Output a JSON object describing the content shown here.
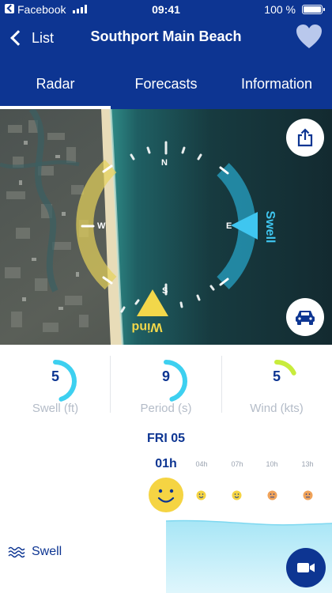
{
  "status_bar": {
    "app_name": "Facebook",
    "time": "09:41",
    "battery": "100 %"
  },
  "nav": {
    "back_label": "List",
    "title": "Southport Main Beach",
    "favorite_icon": "heart-icon"
  },
  "tabs": [
    {
      "label": "Radar",
      "active": true
    },
    {
      "label": "Forecasts",
      "active": false
    },
    {
      "label": "Information",
      "active": false
    }
  ],
  "radar": {
    "compass": {
      "north": "N",
      "south": "S",
      "east": "E",
      "west": "W"
    },
    "swell_label": "Swell",
    "wind_label": "Wind",
    "swell_color": "#2bbde6",
    "wind_color": "#e6d25a",
    "share_icon": "share-icon",
    "car_icon": "car-icon"
  },
  "stats": [
    {
      "value": "5",
      "label": "Swell (ft)",
      "ring_color": "#3dd0f0",
      "level": 0.45
    },
    {
      "value": "9",
      "label": "Period (s)",
      "ring_color": "#3dd0f0",
      "level": 0.45
    },
    {
      "value": "5",
      "label": "Wind (kts)",
      "ring_color": "#c8ec3c",
      "level": 0.18
    }
  ],
  "forecast": {
    "day": "FRI 05",
    "hours": [
      {
        "label": "01h",
        "selected": true
      },
      {
        "label": "04h",
        "selected": false
      },
      {
        "label": "07h",
        "selected": false
      },
      {
        "label": "10h",
        "selected": false
      },
      {
        "label": "13h",
        "selected": false
      }
    ]
  },
  "legend": {
    "swell_label": "Swell",
    "icon": "waves-icon"
  },
  "video_icon": "video-camera-icon",
  "colors": {
    "brand_blue": "#0d3592",
    "face_yellow": "#f5d443",
    "face_orange": "#f0a35a"
  }
}
